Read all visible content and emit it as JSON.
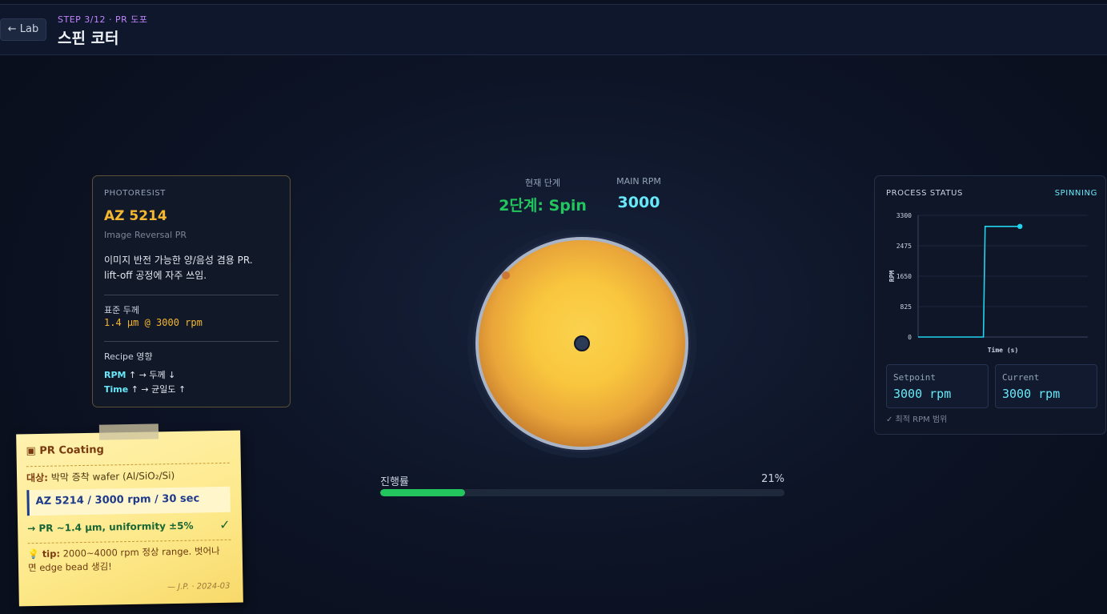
{
  "header": {
    "back_label": "← Lab",
    "step": "STEP 3/12 · PR 도포",
    "title": "스핀 코터"
  },
  "photoresist": {
    "caption": "PHOTORESIST",
    "name": "AZ 5214",
    "type": "Image Reversal PR",
    "desc_line1": "이미지 반전 가능한 양/음성 겸용 PR.",
    "desc_line2": "lift-off 공정에 자주 쓰임.",
    "thickness_label": "표준 두께",
    "thickness_value": "1.4 µm @ 3000 rpm",
    "recipe_label": "Recipe 영향",
    "effects": [
      {
        "key": "RPM",
        "text": " ↑ → 두께 ↓"
      },
      {
        "key": "Time",
        "text": " ↑ → 균일도 ↑"
      }
    ]
  },
  "stage": {
    "current_label": "현재 단계",
    "current_value": "2단계: Spin",
    "rpm_label": "MAIN RPM",
    "rpm_value": "3000"
  },
  "progress": {
    "label": "진행률",
    "percent_text": "21%",
    "fraction": 0.21
  },
  "status": {
    "caption": "PROCESS STATUS",
    "state": "SPINNING",
    "setpoint_label": "Setpoint",
    "setpoint_value": "3000 rpm",
    "current_label": "Current",
    "current_value": "3000 rpm",
    "note": "✓ 최적 RPM 범위"
  },
  "chart_data": {
    "type": "line",
    "title": "",
    "xlabel": "Time (s)",
    "ylabel": "RPM",
    "ylim": [
      0,
      3300
    ],
    "yticks": [
      0,
      825,
      1650,
      2475,
      3300
    ],
    "ytick_labels": [
      "0",
      "825",
      "1650",
      "2475",
      "3300"
    ],
    "series": [
      {
        "x": [
          0,
          7.7,
          7.9,
          12
        ],
        "y": [
          0,
          0,
          3000,
          3000
        ]
      }
    ],
    "xlim": [
      0,
      20
    ],
    "grid": true,
    "color": "#22d3ee"
  },
  "note": {
    "title": "PR Coating",
    "target_key": "대상:",
    "target_text": " 박막 증착 wafer (Al/SiO₂/Si)",
    "recipe": "AZ 5214 / 3000 rpm / 30 sec",
    "result": "→ PR ~1.4 µm, uniformity ±5%",
    "check": "✓",
    "tip_key": "tip:",
    "tip_text": " 2000~4000 rpm 정상 range. 벗어나면 edge bead 생김!",
    "signature": "— J.P. · 2024-03"
  },
  "colors": {
    "accent_green": "#22c55e",
    "accent_cyan": "#67e8f9",
    "accent_amber": "#f5b731",
    "step_purple": "#c084fc"
  }
}
